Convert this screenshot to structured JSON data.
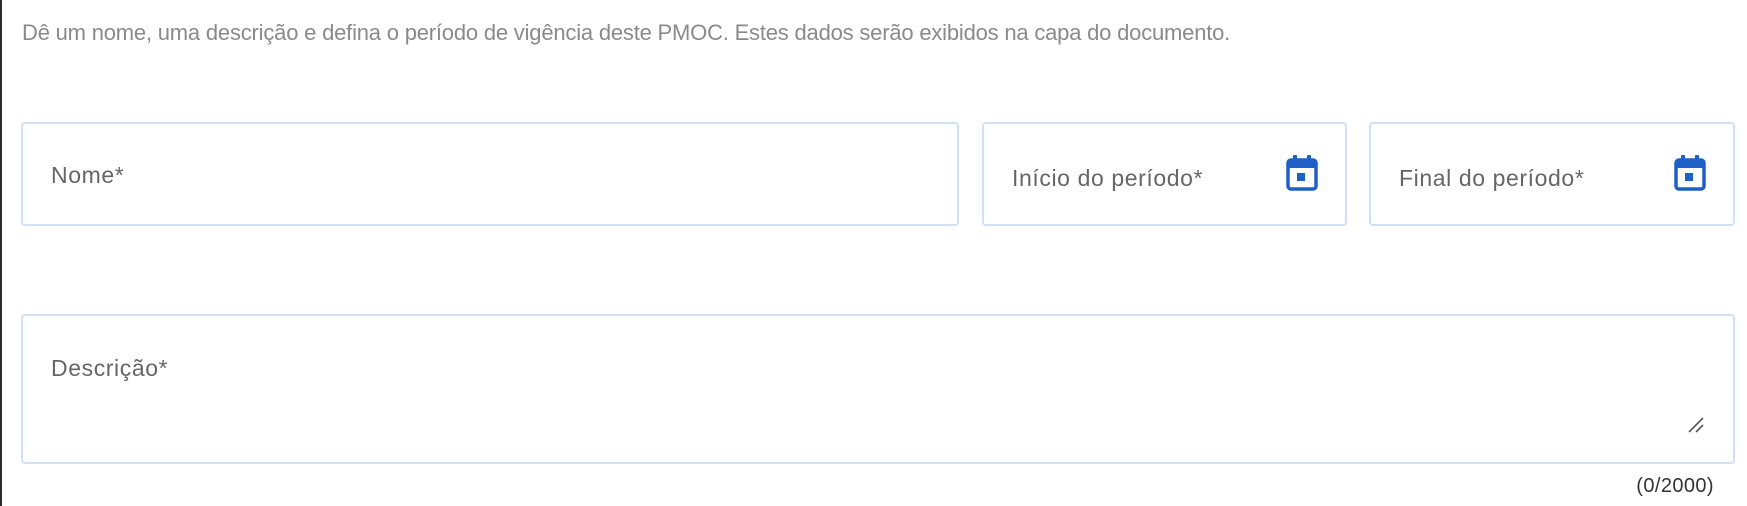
{
  "intro": {
    "text": "Dê um nome, uma descrição e defina o período de vigência deste PMOC. Estes dados serão exibidos na capa do documento."
  },
  "form": {
    "nome": {
      "label": "Nome*",
      "value": ""
    },
    "inicio": {
      "label": "Início do período*",
      "value": "",
      "icon": "calendar-icon"
    },
    "final": {
      "label": "Final do período*",
      "value": "",
      "icon": "calendar-icon"
    },
    "descricao": {
      "label": "Descrição*",
      "value": "",
      "counter": "(0/2000)"
    }
  },
  "colors": {
    "accent": "#1f5fc8",
    "field_border": "#cfe0f7",
    "label_text": "#666666",
    "intro_text": "#8a8a8a"
  }
}
